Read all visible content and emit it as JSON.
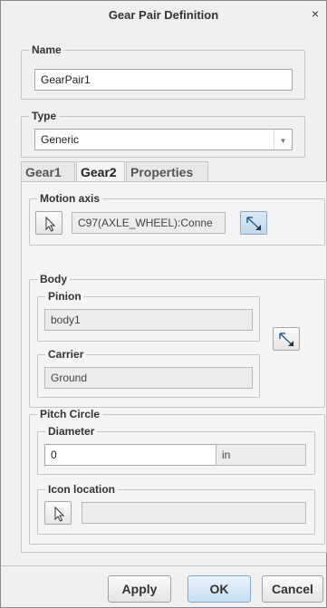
{
  "window": {
    "title": "Gear Pair Definition",
    "close_glyph": "×"
  },
  "name_section": {
    "legend": "Name",
    "value": "GearPair1"
  },
  "type_section": {
    "legend": "Type",
    "value": "Generic",
    "options_visible": [
      "Generic"
    ]
  },
  "tabs": [
    {
      "label": "Gear1",
      "active": false
    },
    {
      "label": "Gear2",
      "active": true
    },
    {
      "label": "Properties",
      "active": false
    }
  ],
  "motion_axis": {
    "legend": "Motion axis",
    "value": "C97(AXLE_WHEEL):Conne",
    "select_icon": "cursor-arrow-icon",
    "flip_icon": "flip-direction-icon"
  },
  "body": {
    "legend": "Body",
    "pinion_label": "Pinion",
    "pinion_value": "body1",
    "carrier_label": "Carrier",
    "carrier_value": "Ground",
    "swap_icon": "swap-bodies-icon"
  },
  "pitch_circle": {
    "legend": "Pitch Circle",
    "diameter_label": "Diameter",
    "diameter_value": "0",
    "unit": "in",
    "icon_location_label": "Icon location",
    "icon_location_value": "",
    "select_icon": "cursor-arrow-icon"
  },
  "footer": {
    "apply_label": "Apply",
    "ok_label": "OK",
    "cancel_label": "Cancel"
  },
  "colors": {
    "accent": "#2b5f8f",
    "background": "#f0f0f0",
    "panel": "#f4f4f4"
  }
}
